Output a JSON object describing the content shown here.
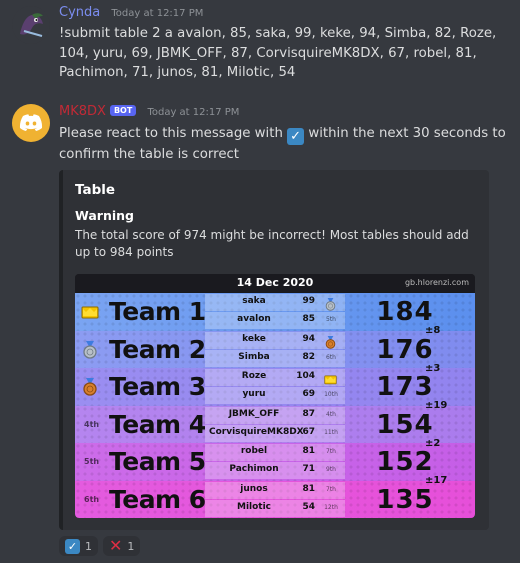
{
  "message1": {
    "username": "Cynda",
    "timestamp": "Today at 12:17 PM",
    "text": "!submit table 2 a avalon, 85, saka, 99, keke, 94, Simba, 82, Roze, 104, yuru, 69, JBMK_OFF, 87, CorvisquireMK8DX, 67, robel, 81, Pachimon, 71, junos, 81, Milotic, 54"
  },
  "message2": {
    "username": "MK8DX",
    "bot_tag": "BOT",
    "timestamp": "Today at 12:17 PM",
    "text_before": "Please react to this message with ",
    "text_after": " within the next 30 seconds to confirm the table is correct",
    "embed": {
      "title": "Table",
      "field_name": "Warning",
      "field_value": "The total score of 974 might be incorrect! Most tables should add up to 984 points",
      "table": {
        "date": "14 Dec 2020",
        "source": "gb.hlorenzi.com",
        "teams": [
          {
            "rank": "",
            "icon": "crown",
            "name": "Team 1",
            "total": "184",
            "diff": "±8",
            "color_a": "#7aa4f2",
            "color_b": "#5b8fee",
            "players": [
              {
                "name": "saka",
                "score": "99",
                "place": "",
                "medal": "silver"
              },
              {
                "name": "avalon",
                "score": "85",
                "place": "5th",
                "medal": ""
              }
            ]
          },
          {
            "rank": "",
            "icon": "silver",
            "name": "Team 2",
            "total": "176",
            "diff": "±3",
            "color_a": "#8c9cf2",
            "color_b": "#7f8bef",
            "players": [
              {
                "name": "keke",
                "score": "94",
                "place": "",
                "medal": "bronze"
              },
              {
                "name": "Simba",
                "score": "82",
                "place": "6th",
                "medal": ""
              }
            ]
          },
          {
            "rank": "",
            "icon": "bronze",
            "name": "Team 3",
            "total": "173",
            "diff": "±19",
            "color_a": "#9a8ef1",
            "color_b": "#9283ef",
            "players": [
              {
                "name": "Roze",
                "score": "104",
                "place": "",
                "medal": "crown"
              },
              {
                "name": "yuru",
                "score": "69",
                "place": "10th",
                "medal": ""
              }
            ]
          },
          {
            "rank": "4th",
            "icon": "",
            "name": "Team 4",
            "total": "154",
            "diff": "±2",
            "color_a": "#b585ef",
            "color_b": "#aa7bed",
            "players": [
              {
                "name": "JBMK_OFF",
                "score": "87",
                "place": "4th",
                "medal": ""
              },
              {
                "name": "CorvisquireMK8DX",
                "score": "67",
                "place": "11th",
                "medal": ""
              }
            ]
          },
          {
            "rank": "5th",
            "icon": "",
            "name": "Team 5",
            "total": "152",
            "diff": "±17",
            "color_a": "#cc6ce9",
            "color_b": "#c55ee7",
            "players": [
              {
                "name": "robel",
                "score": "81",
                "place": "7th",
                "medal": ""
              },
              {
                "name": "Pachimon",
                "score": "71",
                "place": "9th",
                "medal": ""
              }
            ]
          },
          {
            "rank": "6th",
            "icon": "",
            "name": "Team 6",
            "total": "135",
            "diff": "",
            "color_a": "#e45bdf",
            "color_b": "#e64fd9",
            "players": [
              {
                "name": "junos",
                "score": "81",
                "place": "7th",
                "medal": ""
              },
              {
                "name": "Milotic",
                "score": "54",
                "place": "12th",
                "medal": ""
              }
            ]
          }
        ]
      }
    },
    "reactions": [
      {
        "emoji": "check-icon",
        "count": "1"
      },
      {
        "emoji": "x-icon",
        "count": "1"
      }
    ]
  },
  "colors": {
    "background": "#36393f",
    "embed_bg": "#2f3136",
    "cynda_name": "#7b8df0",
    "bot_name": "#c12a36",
    "bot_tag": "#5865f2",
    "avatar_bot": "#f0b232"
  }
}
